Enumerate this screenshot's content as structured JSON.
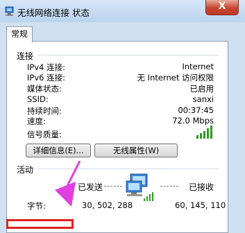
{
  "window": {
    "title": "无线网络连接 状态",
    "close_glyph": "X",
    "icon": "network-connection-icon"
  },
  "tabs": [
    {
      "label": "常规"
    }
  ],
  "connection": {
    "header": "连接",
    "rows": [
      {
        "label": "IPv4 连接:",
        "value": "Internet"
      },
      {
        "label": "IPv6 连接:",
        "value": "无 Internet 访问权限"
      },
      {
        "label": "媒体状态:",
        "value": "已启用"
      },
      {
        "label": "SSID:",
        "value": "sanxi"
      },
      {
        "label": "持续时间:",
        "value": "00:37:45"
      },
      {
        "label": "速度:",
        "value": "72.0 Mbps"
      }
    ],
    "signal_label": "信号质量:",
    "signal_bars": 5,
    "details_button": "详细信息(E)...",
    "wireless_props_button": "无线属性(W)"
  },
  "activity": {
    "header": "活动",
    "sent_label": "已发送",
    "received_label": "已接收",
    "bytes_label": "字节:",
    "bytes_sent": "30, 502, 288",
    "bytes_received": "60, 145, 110",
    "icon": "network-computers-icon",
    "annotation_color": "#e040e0",
    "highlight_color": "#e02020"
  },
  "colors": {
    "signal_green": "#2f9a24",
    "window_frame": "#cfe0f2"
  }
}
